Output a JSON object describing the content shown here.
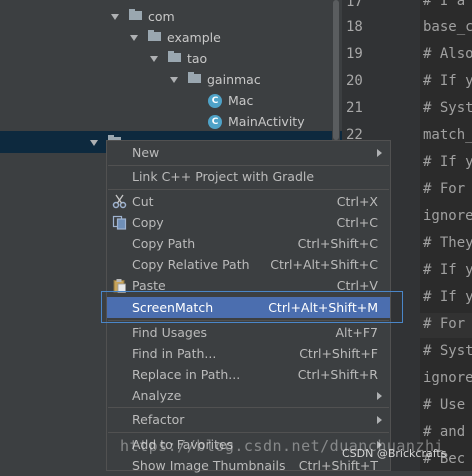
{
  "tree": {
    "items": [
      {
        "label": "com"
      },
      {
        "label": "example"
      },
      {
        "label": "tao"
      },
      {
        "label": "gainmac"
      },
      {
        "label": "Mac",
        "icon_letter": "C"
      },
      {
        "label": "MainActivity",
        "icon_letter": "C"
      }
    ]
  },
  "gutter": {
    "line_numbers": [
      "17",
      "18",
      "19",
      "20",
      "21",
      "22"
    ]
  },
  "editor": {
    "lines": [
      "# I a",
      "base_c",
      "# Also",
      "# If y",
      "# Syst",
      "match_",
      "# If y",
      "# For",
      "ignore",
      "# They",
      "# If y",
      "# If y",
      "# For",
      "# Syst",
      "ignore",
      "# Use",
      "# and",
      "# Bec"
    ]
  },
  "menu": {
    "new": "New",
    "link_cpp": "Link C++ Project with Gradle",
    "cut": "Cut",
    "cut_sc": "Ctrl+X",
    "copy": "Copy",
    "copy_sc": "Ctrl+C",
    "copy_path": "Copy Path",
    "copy_path_sc": "Ctrl+Shift+C",
    "copy_rel": "Copy Relative Path",
    "copy_rel_sc": "Ctrl+Alt+Shift+C",
    "paste": "Paste",
    "paste_sc": "Ctrl+V",
    "screenmatch": "ScreenMatch",
    "screenmatch_sc": "Ctrl+Alt+Shift+M",
    "find_usages": "Find Usages",
    "find_usages_sc": "Alt+F7",
    "find_in_path": "Find in Path...",
    "find_in_path_sc": "Ctrl+Shift+F",
    "replace_in_path": "Replace in Path...",
    "replace_in_path_sc": "Ctrl+Shift+R",
    "analyze": "Analyze",
    "refactor": "Refactor",
    "add_favorites": "Add to Favorites",
    "show_thumbs": "Show Image Thumbnails",
    "show_thumbs_sc": "Ctrl+Shift+T"
  },
  "watermark": "https://blog.csdn.net/duanchuanzhi",
  "csdn_credit": "CSDN @Brickcrafts",
  "colors": {
    "highlight": "#4b6eaf",
    "menu_bg": "#3c3f41",
    "editor_bg": "#2b2b2b"
  }
}
